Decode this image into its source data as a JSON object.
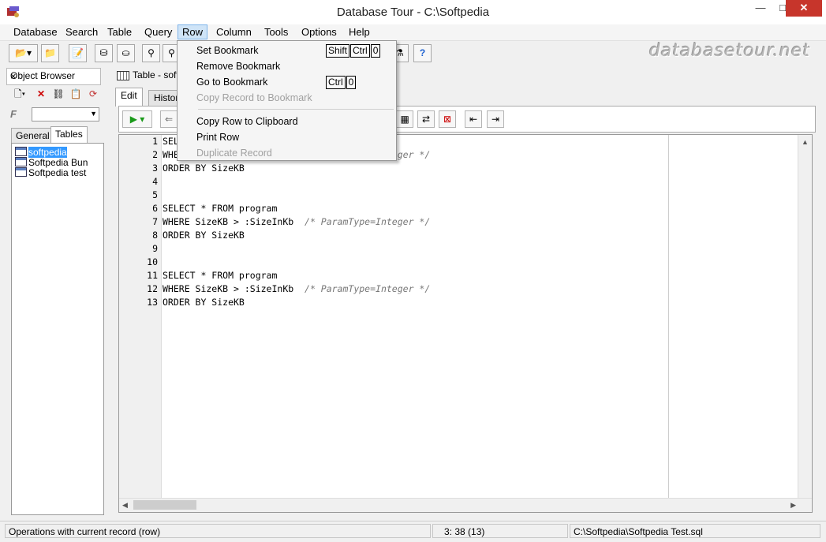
{
  "window": {
    "title": "Database Tour - C:\\Softpedia",
    "minimize": "—",
    "maximize": "□",
    "close": "✕"
  },
  "menubar": {
    "items": [
      "Database",
      "Search",
      "Table",
      "Query",
      "Row",
      "Column",
      "Tools",
      "Options",
      "Help"
    ],
    "active": "Row"
  },
  "watermark": "databasetour.net",
  "object_browser": {
    "title": "Object Browser",
    "close": "×",
    "filter_label": "F",
    "tabs": [
      "General",
      "Tables"
    ],
    "selected_tab": "Tables",
    "tables": [
      "softpedia",
      "Softpedia Bun",
      "Softpedia test"
    ],
    "selected_table": "softpedia"
  },
  "document": {
    "tab_label": "Table - soft",
    "inner_tabs": [
      "Edit",
      "Histor"
    ],
    "selected_inner_tab": "Edit"
  },
  "row_menu": {
    "items": [
      {
        "label": "Set Bookmark",
        "keys": [
          "Shift",
          "Ctrl",
          "0"
        ],
        "enabled": true
      },
      {
        "label": "Remove Bookmark",
        "keys": [],
        "enabled": true
      },
      {
        "label": "Go to Bookmark",
        "keys": [
          "Ctrl",
          "0"
        ],
        "enabled": true
      },
      {
        "label": "Copy Record to Bookmark",
        "keys": [],
        "enabled": false
      },
      {
        "label": "Copy Row to Clipboard",
        "keys": [],
        "enabled": true
      },
      {
        "label": "Print Row",
        "keys": [],
        "enabled": true
      },
      {
        "label": "Duplicate Record",
        "keys": [],
        "enabled": false
      }
    ]
  },
  "editor": {
    "lines": [
      {
        "n": "1",
        "code": "SELECT * FROM program",
        "comment": ""
      },
      {
        "n": "2",
        "code": "WHERE SizeKB > :SizeInKb  ",
        "comment": "/* ParamType=Integer */"
      },
      {
        "n": "3",
        "code": "ORDER BY SizeKB",
        "comment": ""
      },
      {
        "n": "4",
        "code": "",
        "comment": ""
      },
      {
        "n": "5",
        "code": "",
        "comment": ""
      },
      {
        "n": "6",
        "code": "SELECT * FROM program",
        "comment": ""
      },
      {
        "n": "7",
        "code": "WHERE SizeKB > :SizeInKb  ",
        "comment": "/* ParamType=Integer */"
      },
      {
        "n": "8",
        "code": "ORDER BY SizeKB",
        "comment": ""
      },
      {
        "n": "9",
        "code": "",
        "comment": ""
      },
      {
        "n": "10",
        "code": "",
        "comment": ""
      },
      {
        "n": "11",
        "code": "SELECT * FROM program",
        "comment": ""
      },
      {
        "n": "12",
        "code": "WHERE SizeKB > :SizeInKb  ",
        "comment": "/* ParamType=Integer */"
      },
      {
        "n": "13",
        "code": "ORDER BY SizeKB",
        "comment": ""
      }
    ]
  },
  "statusbar": {
    "message": "Operations with current record (row)",
    "position": "3:  38  (13)",
    "file": "C:\\Softpedia\\Softpedia Test.sql"
  }
}
